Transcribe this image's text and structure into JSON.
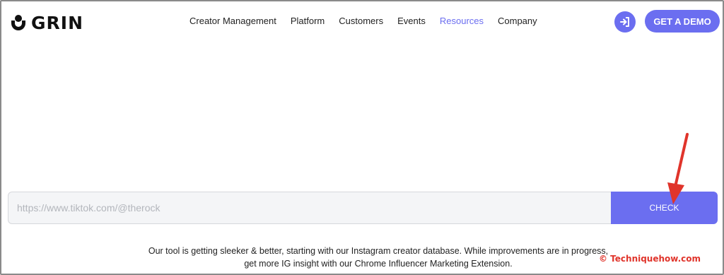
{
  "header": {
    "logo_text": "GRIN",
    "nav": [
      "Creator Management",
      "Platform",
      "Customers",
      "Events",
      "Resources",
      "Company"
    ],
    "active_nav": "Resources",
    "demo_label": "GET A DEMO"
  },
  "search": {
    "placeholder": "https://www.tiktok.com/@therock",
    "value": "",
    "check_label": "CHECK"
  },
  "info": {
    "line1": "Our tool is getting sleeker & better, starting with our Instagram creator database. While improvements are in progress,",
    "line2": "get more IG insight with our Chrome Influencer Marketing Extension."
  },
  "watermark": "© Techniquehow.com",
  "colors": {
    "accent": "#6b6ef0",
    "annotation": "#e0342b"
  },
  "icons": {
    "login": "login-icon",
    "arrow": "red-arrow-annotation"
  }
}
